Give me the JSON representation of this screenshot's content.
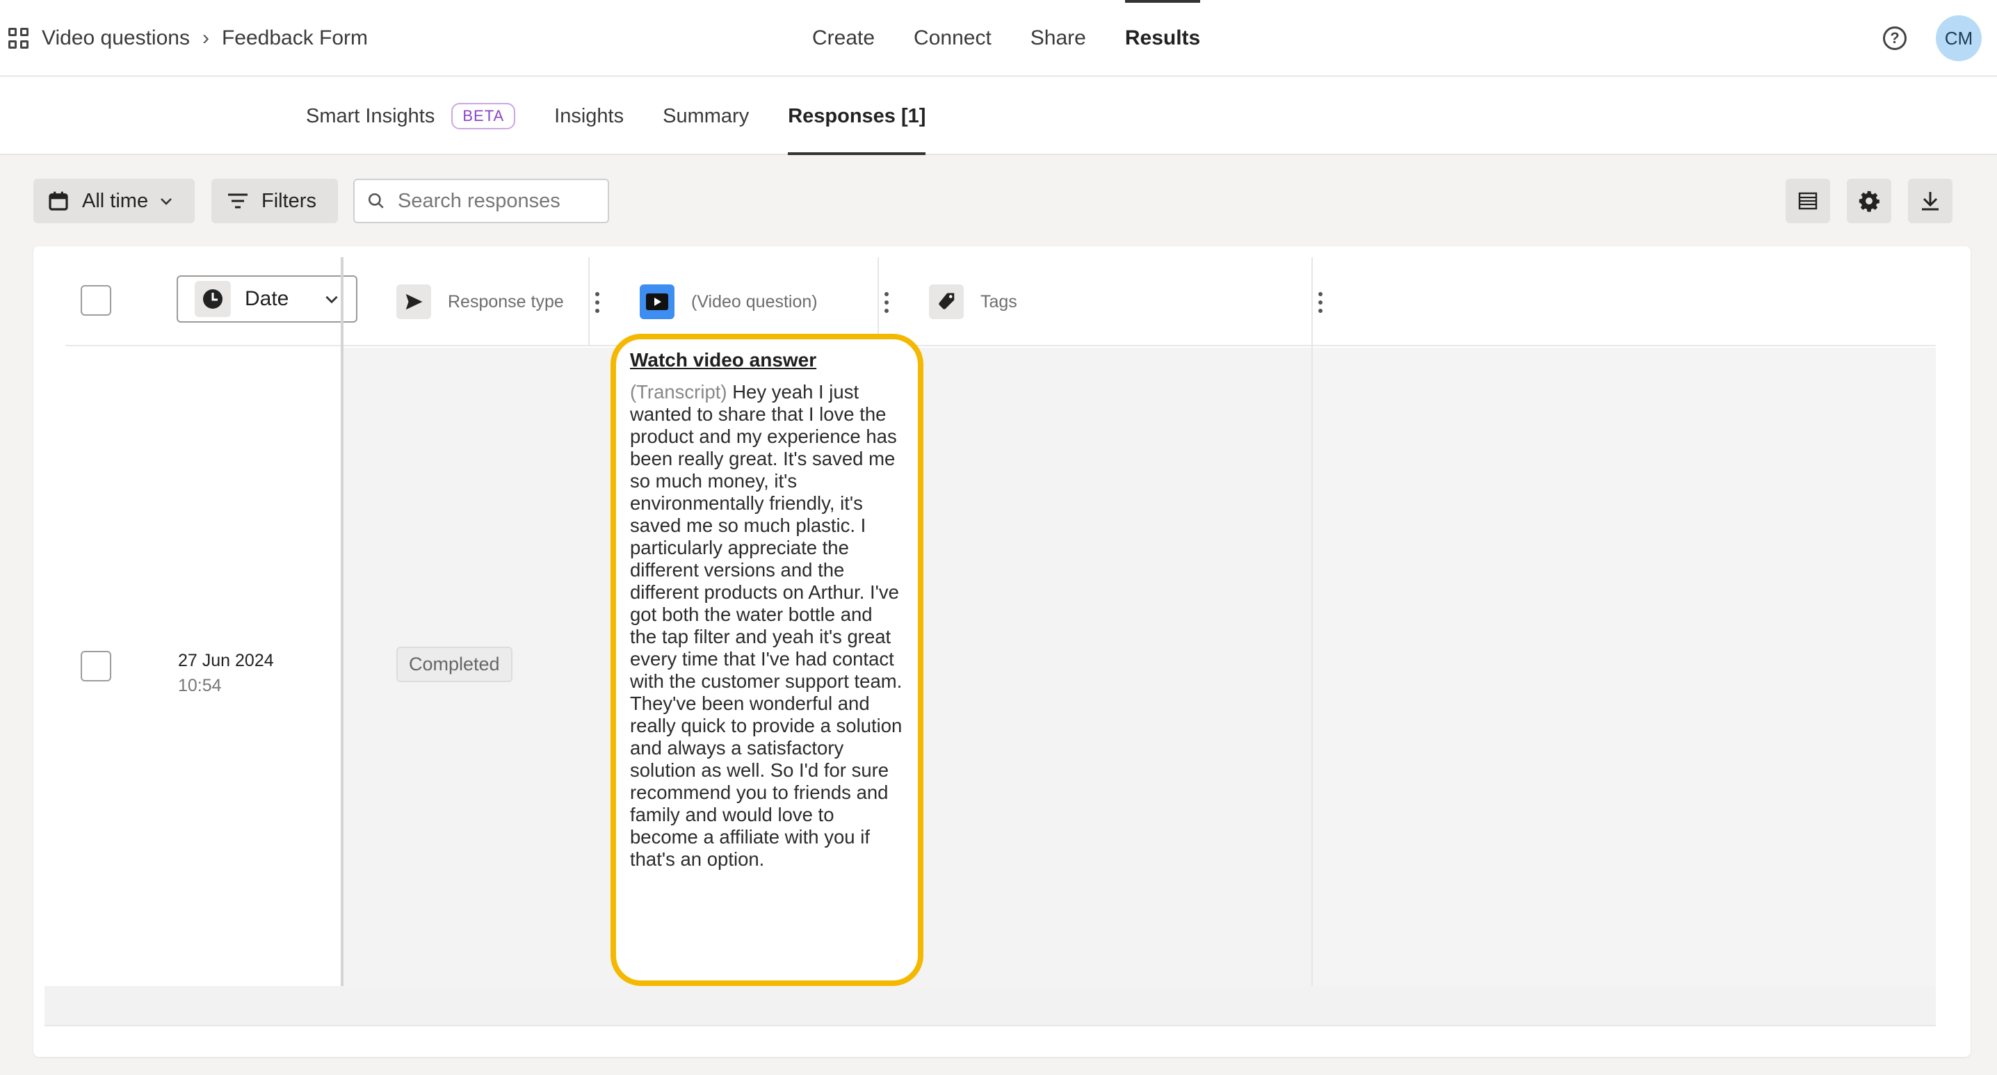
{
  "breadcrumb": {
    "project": "Video questions",
    "form": "Feedback Form"
  },
  "topnav": [
    {
      "label": "Create"
    },
    {
      "label": "Connect"
    },
    {
      "label": "Share"
    },
    {
      "label": "Results",
      "active": true
    }
  ],
  "user": {
    "initials": "CM",
    "help_symbol": "?"
  },
  "tabs": {
    "smart_insights": "Smart Insights",
    "beta_badge": "BETA",
    "insights": "Insights",
    "summary": "Summary",
    "responses": "Responses [1]"
  },
  "toolbar": {
    "time_filter": "All time",
    "filters": "Filters",
    "search_placeholder": "Search responses"
  },
  "table": {
    "sort_column": "Date",
    "columns": [
      {
        "label": "Response type",
        "icon": "send-icon"
      },
      {
        "label": "(Video question)",
        "icon": "video-icon"
      },
      {
        "label": "Tags",
        "icon": "tag-icon"
      }
    ],
    "rows": [
      {
        "date": "27 Jun 2024",
        "time": "10:54",
        "response_type": "Completed",
        "video_link": "Watch video answer",
        "transcript_label": "(Transcript)",
        "transcript": "Hey yeah I just wanted to share that I love the product and my experience has been really great. It's saved me so much money, it's environmentally friendly, it's saved me so much plastic. I particularly appreciate the different versions and the different products on Arthur. I've got both the water bottle and the tap filter and yeah it's great every time that I've had contact with the customer support team. They've been wonderful and really quick to provide a solution and always a satisfactory solution as well. So I'd for sure recommend you to friends and family and would love to become a affiliate with you if that's an option."
      }
    ]
  },
  "colors": {
    "highlight": "#f5b800",
    "beta": "#8a46c4",
    "avatar_bg": "#b7dbf6"
  }
}
